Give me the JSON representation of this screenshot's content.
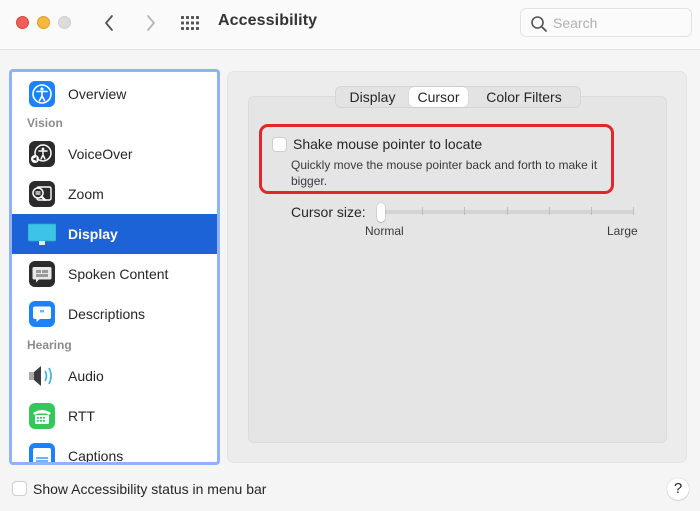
{
  "window": {
    "title": "Accessibility",
    "search_placeholder": "Search",
    "search_value": ""
  },
  "sidebar": {
    "selected": "Display",
    "sections": [
      {
        "label": "Vision"
      },
      {
        "label": "Hearing"
      }
    ],
    "items": [
      {
        "label": "Overview",
        "icon": "accessibility-icon",
        "color": "#1a82fb"
      },
      {
        "label": "VoiceOver",
        "icon": "voiceover-icon",
        "color": "#2b2b2b"
      },
      {
        "label": "Zoom",
        "icon": "zoom-icon",
        "color": "#2b2b2b"
      },
      {
        "label": "Display",
        "icon": "display-icon",
        "color": "#35bde0"
      },
      {
        "label": "Spoken Content",
        "icon": "spoken-content-icon",
        "color": "#2b2b2b"
      },
      {
        "label": "Descriptions",
        "icon": "descriptions-icon",
        "color": "#1a82fb"
      },
      {
        "label": "Audio",
        "icon": "audio-icon",
        "color": "#9a9a9a"
      },
      {
        "label": "RTT",
        "icon": "rtt-icon",
        "color": "#34c759"
      },
      {
        "label": "Captions",
        "icon": "captions-icon",
        "color": "#1a82fb"
      }
    ]
  },
  "tabs": {
    "items": [
      {
        "label": "Display"
      },
      {
        "label": "Cursor"
      },
      {
        "label": "Color Filters"
      }
    ],
    "selected": "Cursor"
  },
  "cursor_pane": {
    "shake": {
      "label": "Shake mouse pointer to locate",
      "description": "Quickly move the mouse pointer back and forth to make it bigger.",
      "checked": false,
      "highlight_color": "#e3262b"
    },
    "cursor_size": {
      "label": "Cursor size:",
      "min_label": "Normal",
      "max_label": "Large",
      "value_fraction": 0.0,
      "tick_count": 7
    }
  },
  "footer": {
    "status_checkbox_label": "Show Accessibility status in menu bar",
    "status_checked": false,
    "help_label": "?"
  },
  "colors": {
    "accent": "#1d63d8",
    "focus_ring": "#8fb3f5"
  }
}
